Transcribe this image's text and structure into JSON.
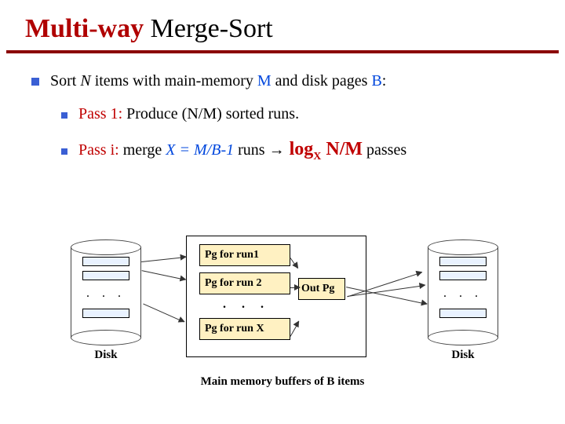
{
  "title": {
    "red": "Multi-way",
    "rest": " Merge-Sort"
  },
  "main_bullet": {
    "prefix": "Sort ",
    "n": "N ",
    "mid": "items with main-memory ",
    "m": "M",
    "mid2": " and disk pages ",
    "b": "B",
    "end": ":"
  },
  "sub1": {
    "label": "Pass 1:",
    "text": " Produce (N/M) sorted runs."
  },
  "sub2": {
    "label": "Pass i:",
    "text1": " merge ",
    "xexpr": "X = M/B-1",
    "text2": " runs ",
    "arrow": "→",
    "log_prefix": " log",
    "log_sub": "X",
    "log_arg": " N/M",
    "passes": " passes"
  },
  "diagram": {
    "disk_left": "Disk",
    "disk_right": "Disk",
    "cyl_dots": ". . .",
    "pg_run1": "Pg for run1",
    "pg_run2": "Pg for run 2",
    "pg_runx": "Pg for run X",
    "mem_dots": ". . .",
    "out_pg": "Out Pg",
    "caption": "Main memory buffers of B items"
  }
}
